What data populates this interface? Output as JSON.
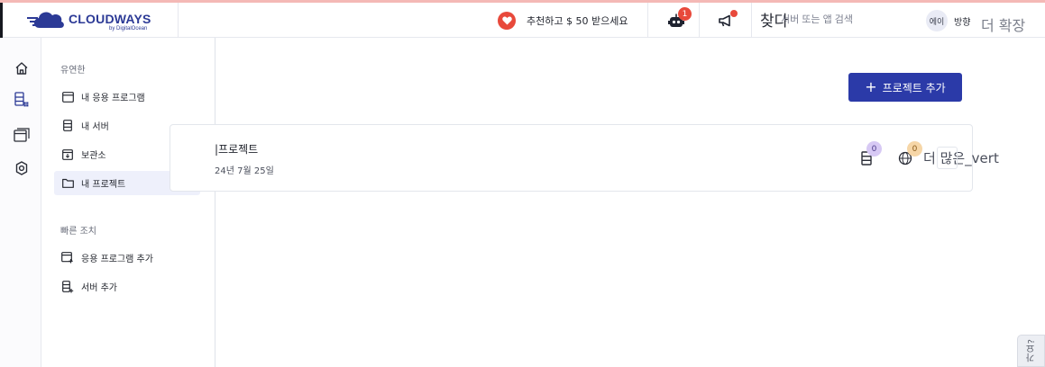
{
  "brand": {
    "name": "CLOUDWAYS",
    "sub": "by DigitalOcean",
    "color": "#2c3a96"
  },
  "topbar": {
    "referral_text": "추천하고 $ 50 받으세요",
    "bot_badge": "1",
    "search_label": "찾다",
    "search_placeholder": "서버 또는 앱 검색",
    "avatar_text": "에이",
    "user_label": "방향",
    "more_label": "더 확장"
  },
  "rail": {
    "items": [
      {
        "icon": "home-icon"
      },
      {
        "icon": "servers-apps-icon"
      },
      {
        "icon": "window-icon"
      },
      {
        "icon": "settings-gear-icon"
      }
    ]
  },
  "panel": {
    "useful_label": "유연한",
    "useful_items": [
      {
        "label": "내 응용 프로그램",
        "icon": "app-window-icon"
      },
      {
        "label": "내 서버",
        "icon": "server-icon"
      },
      {
        "label": "보관소",
        "icon": "archive-icon"
      },
      {
        "label": "내 프로젝트",
        "icon": "folder-icon",
        "active": true
      }
    ],
    "quick_label": "빠른 조치",
    "quick_items": [
      {
        "label": "응용 프로그램 추가",
        "icon": "add-app-icon"
      },
      {
        "label": "서버 추가",
        "icon": "add-server-icon"
      }
    ]
  },
  "main": {
    "add_project_label": "프로젝트 추가",
    "project": {
      "name": "|프로젝트",
      "date": "24년 7월 25일",
      "servers_count": "0",
      "apps_count": "0",
      "more_label": "더 많은_vert"
    }
  },
  "help": {
    "label": "가요?"
  },
  "colors": {
    "accent": "#2b3aa8",
    "alert": "#e8493b",
    "active_bg": "#eef0fb"
  }
}
